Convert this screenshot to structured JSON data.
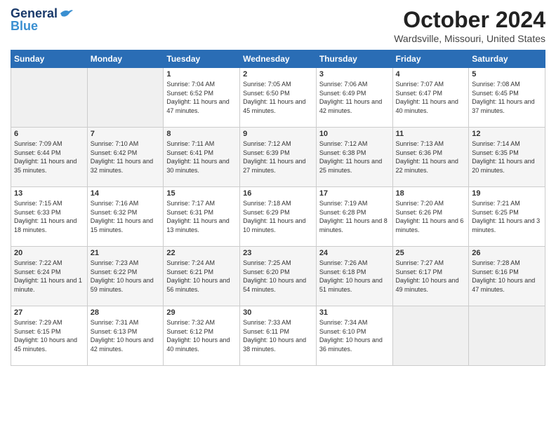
{
  "header": {
    "logo_general": "General",
    "logo_blue": "Blue",
    "month_title": "October 2024",
    "location": "Wardsville, Missouri, United States"
  },
  "days_of_week": [
    "Sunday",
    "Monday",
    "Tuesday",
    "Wednesday",
    "Thursday",
    "Friday",
    "Saturday"
  ],
  "weeks": [
    [
      {
        "day": "",
        "empty": true
      },
      {
        "day": "",
        "empty": true
      },
      {
        "day": "1",
        "sunrise": "Sunrise: 7:04 AM",
        "sunset": "Sunset: 6:52 PM",
        "daylight": "Daylight: 11 hours and 47 minutes."
      },
      {
        "day": "2",
        "sunrise": "Sunrise: 7:05 AM",
        "sunset": "Sunset: 6:50 PM",
        "daylight": "Daylight: 11 hours and 45 minutes."
      },
      {
        "day": "3",
        "sunrise": "Sunrise: 7:06 AM",
        "sunset": "Sunset: 6:49 PM",
        "daylight": "Daylight: 11 hours and 42 minutes."
      },
      {
        "day": "4",
        "sunrise": "Sunrise: 7:07 AM",
        "sunset": "Sunset: 6:47 PM",
        "daylight": "Daylight: 11 hours and 40 minutes."
      },
      {
        "day": "5",
        "sunrise": "Sunrise: 7:08 AM",
        "sunset": "Sunset: 6:45 PM",
        "daylight": "Daylight: 11 hours and 37 minutes."
      }
    ],
    [
      {
        "day": "6",
        "sunrise": "Sunrise: 7:09 AM",
        "sunset": "Sunset: 6:44 PM",
        "daylight": "Daylight: 11 hours and 35 minutes."
      },
      {
        "day": "7",
        "sunrise": "Sunrise: 7:10 AM",
        "sunset": "Sunset: 6:42 PM",
        "daylight": "Daylight: 11 hours and 32 minutes."
      },
      {
        "day": "8",
        "sunrise": "Sunrise: 7:11 AM",
        "sunset": "Sunset: 6:41 PM",
        "daylight": "Daylight: 11 hours and 30 minutes."
      },
      {
        "day": "9",
        "sunrise": "Sunrise: 7:12 AM",
        "sunset": "Sunset: 6:39 PM",
        "daylight": "Daylight: 11 hours and 27 minutes."
      },
      {
        "day": "10",
        "sunrise": "Sunrise: 7:12 AM",
        "sunset": "Sunset: 6:38 PM",
        "daylight": "Daylight: 11 hours and 25 minutes."
      },
      {
        "day": "11",
        "sunrise": "Sunrise: 7:13 AM",
        "sunset": "Sunset: 6:36 PM",
        "daylight": "Daylight: 11 hours and 22 minutes."
      },
      {
        "day": "12",
        "sunrise": "Sunrise: 7:14 AM",
        "sunset": "Sunset: 6:35 PM",
        "daylight": "Daylight: 11 hours and 20 minutes."
      }
    ],
    [
      {
        "day": "13",
        "sunrise": "Sunrise: 7:15 AM",
        "sunset": "Sunset: 6:33 PM",
        "daylight": "Daylight: 11 hours and 18 minutes."
      },
      {
        "day": "14",
        "sunrise": "Sunrise: 7:16 AM",
        "sunset": "Sunset: 6:32 PM",
        "daylight": "Daylight: 11 hours and 15 minutes."
      },
      {
        "day": "15",
        "sunrise": "Sunrise: 7:17 AM",
        "sunset": "Sunset: 6:31 PM",
        "daylight": "Daylight: 11 hours and 13 minutes."
      },
      {
        "day": "16",
        "sunrise": "Sunrise: 7:18 AM",
        "sunset": "Sunset: 6:29 PM",
        "daylight": "Daylight: 11 hours and 10 minutes."
      },
      {
        "day": "17",
        "sunrise": "Sunrise: 7:19 AM",
        "sunset": "Sunset: 6:28 PM",
        "daylight": "Daylight: 11 hours and 8 minutes."
      },
      {
        "day": "18",
        "sunrise": "Sunrise: 7:20 AM",
        "sunset": "Sunset: 6:26 PM",
        "daylight": "Daylight: 11 hours and 6 minutes."
      },
      {
        "day": "19",
        "sunrise": "Sunrise: 7:21 AM",
        "sunset": "Sunset: 6:25 PM",
        "daylight": "Daylight: 11 hours and 3 minutes."
      }
    ],
    [
      {
        "day": "20",
        "sunrise": "Sunrise: 7:22 AM",
        "sunset": "Sunset: 6:24 PM",
        "daylight": "Daylight: 11 hours and 1 minute."
      },
      {
        "day": "21",
        "sunrise": "Sunrise: 7:23 AM",
        "sunset": "Sunset: 6:22 PM",
        "daylight": "Daylight: 10 hours and 59 minutes."
      },
      {
        "day": "22",
        "sunrise": "Sunrise: 7:24 AM",
        "sunset": "Sunset: 6:21 PM",
        "daylight": "Daylight: 10 hours and 56 minutes."
      },
      {
        "day": "23",
        "sunrise": "Sunrise: 7:25 AM",
        "sunset": "Sunset: 6:20 PM",
        "daylight": "Daylight: 10 hours and 54 minutes."
      },
      {
        "day": "24",
        "sunrise": "Sunrise: 7:26 AM",
        "sunset": "Sunset: 6:18 PM",
        "daylight": "Daylight: 10 hours and 51 minutes."
      },
      {
        "day": "25",
        "sunrise": "Sunrise: 7:27 AM",
        "sunset": "Sunset: 6:17 PM",
        "daylight": "Daylight: 10 hours and 49 minutes."
      },
      {
        "day": "26",
        "sunrise": "Sunrise: 7:28 AM",
        "sunset": "Sunset: 6:16 PM",
        "daylight": "Daylight: 10 hours and 47 minutes."
      }
    ],
    [
      {
        "day": "27",
        "sunrise": "Sunrise: 7:29 AM",
        "sunset": "Sunset: 6:15 PM",
        "daylight": "Daylight: 10 hours and 45 minutes."
      },
      {
        "day": "28",
        "sunrise": "Sunrise: 7:31 AM",
        "sunset": "Sunset: 6:13 PM",
        "daylight": "Daylight: 10 hours and 42 minutes."
      },
      {
        "day": "29",
        "sunrise": "Sunrise: 7:32 AM",
        "sunset": "Sunset: 6:12 PM",
        "daylight": "Daylight: 10 hours and 40 minutes."
      },
      {
        "day": "30",
        "sunrise": "Sunrise: 7:33 AM",
        "sunset": "Sunset: 6:11 PM",
        "daylight": "Daylight: 10 hours and 38 minutes."
      },
      {
        "day": "31",
        "sunrise": "Sunrise: 7:34 AM",
        "sunset": "Sunset: 6:10 PM",
        "daylight": "Daylight: 10 hours and 36 minutes."
      },
      {
        "day": "",
        "empty": true
      },
      {
        "day": "",
        "empty": true
      }
    ]
  ]
}
